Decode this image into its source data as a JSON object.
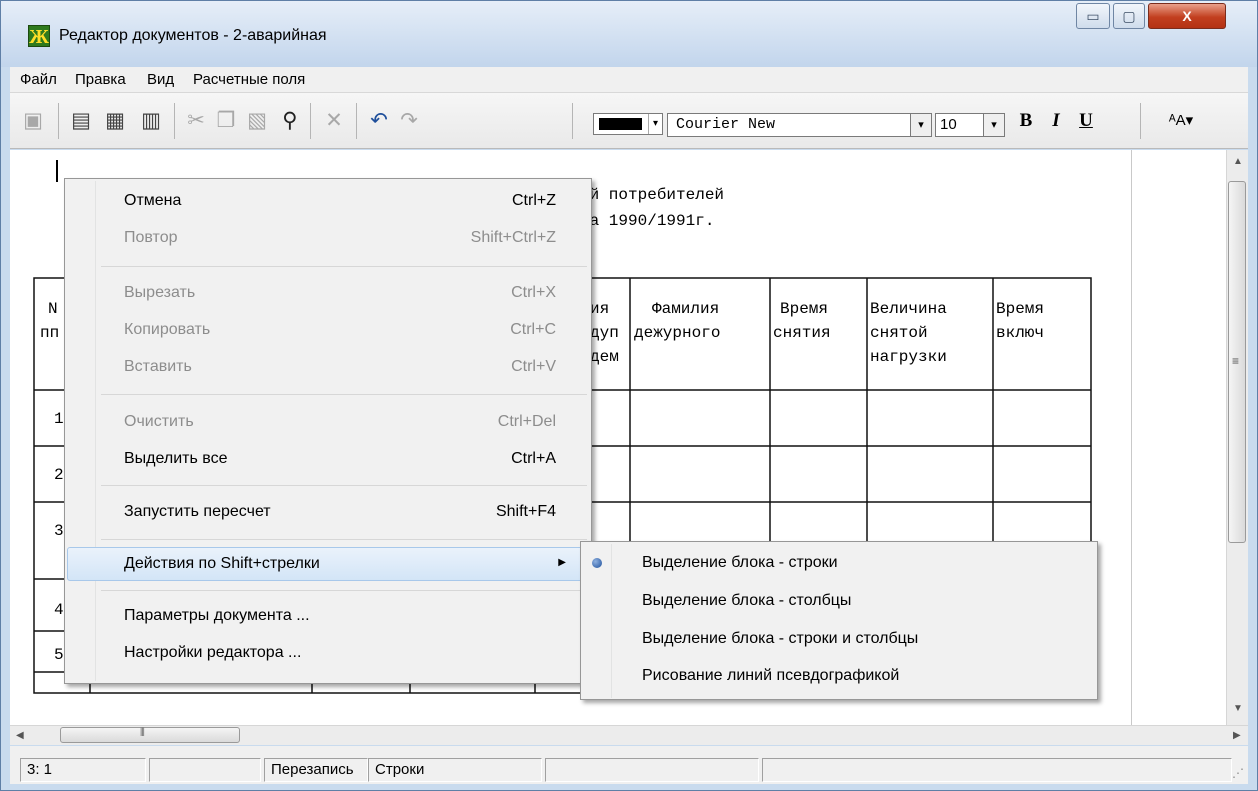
{
  "window": {
    "title": "Редактор документов - 2-аварийная",
    "app_icon_glyph": "Ж",
    "minimize_glyph": "▭",
    "maximize_glyph": "▢",
    "close_glyph": "X"
  },
  "menubar": [
    "Файл",
    "Правка",
    "Вид",
    "Расчетные поля"
  ],
  "toolbar": {
    "icons": [
      "save-icon",
      "page-setup-icon",
      "print-preview-icon",
      "print-icon",
      "cut-icon",
      "copy-icon",
      "paste-icon",
      "find-icon",
      "delete-icon",
      "undo-icon",
      "redo-icon"
    ],
    "glyphs": {
      "save": "▣",
      "page_setup": "▤",
      "print_preview": "▦",
      "print": "▥",
      "cut": "✂",
      "copy": "❐",
      "paste": "▧",
      "find": "⚲",
      "delete": "✕",
      "undo": "↶",
      "redo": "↷",
      "dropdown": "▾"
    },
    "text_color": "#000000",
    "font": "Courier New",
    "font_size": "10",
    "bold_label": "B",
    "italic_label": "I",
    "underline_label": "U",
    "char_format_label": "ᴬA▾"
  },
  "document": {
    "line1": "ий потребителей",
    "line2": "на 1990/1991г.",
    "header_left": {
      "r1": "N",
      "r2": "пп"
    },
    "header_partial": {
      "r1": "ия",
      "r2": "дуп",
      "r3": "дем"
    },
    "columns": [
      {
        "r1": "Фамилия",
        "r2": "дежурного",
        "r3": ""
      },
      {
        "r1": "Время",
        "r2": "снятия",
        "r3": ""
      },
      {
        "r1": "Величина",
        "r2": "снятой",
        "r3": "нагрузки"
      },
      {
        "r1": "Время",
        "r2": "включ",
        "r3": ""
      }
    ],
    "row_numbers": [
      "1",
      "2",
      "3",
      "4",
      "5"
    ]
  },
  "context_menu": {
    "items": [
      {
        "label": "Отмена",
        "shortcut": "Ctrl+Z",
        "enabled": true
      },
      {
        "label": "Повтор",
        "shortcut": "Shift+Ctrl+Z",
        "enabled": false
      },
      {
        "label": "Вырезать",
        "shortcut": "Ctrl+X",
        "enabled": false
      },
      {
        "label": "Копировать",
        "shortcut": "Ctrl+C",
        "enabled": false
      },
      {
        "label": "Вставить",
        "shortcut": "Ctrl+V",
        "enabled": false
      },
      {
        "label": "Очистить",
        "shortcut": "Ctrl+Del",
        "enabled": false
      },
      {
        "label": "Выделить все",
        "shortcut": "Ctrl+A",
        "enabled": true
      },
      {
        "label": "Запустить пересчет",
        "shortcut": "Shift+F4",
        "enabled": true
      },
      {
        "label": "Действия по Shift+стрелки",
        "shortcut": "",
        "enabled": true,
        "submenu": true,
        "highlighted": true
      },
      {
        "label": "Параметры документа ...",
        "shortcut": "",
        "enabled": true
      },
      {
        "label": "Настройки редактора ...",
        "shortcut": "",
        "enabled": true
      }
    ],
    "submenu_arrow": "▶"
  },
  "submenu": {
    "items": [
      {
        "label": "Выделение блока - строки",
        "selected": true
      },
      {
        "label": "Выделение блока - столбцы",
        "selected": false
      },
      {
        "label": "Выделение блока - строки и столбцы",
        "selected": false
      },
      {
        "label": "Рисование линий псевдографикой",
        "selected": false
      }
    ]
  },
  "scrollbars": {
    "up": "▲",
    "down": "▼",
    "left": "◀",
    "right": "▶",
    "grip_v": "≡",
    "grip_h": "⦀"
  },
  "statusbar": {
    "position": "3: 1",
    "mode": "Перезапись",
    "selection": "Строки",
    "resize_grip": "⋰"
  }
}
